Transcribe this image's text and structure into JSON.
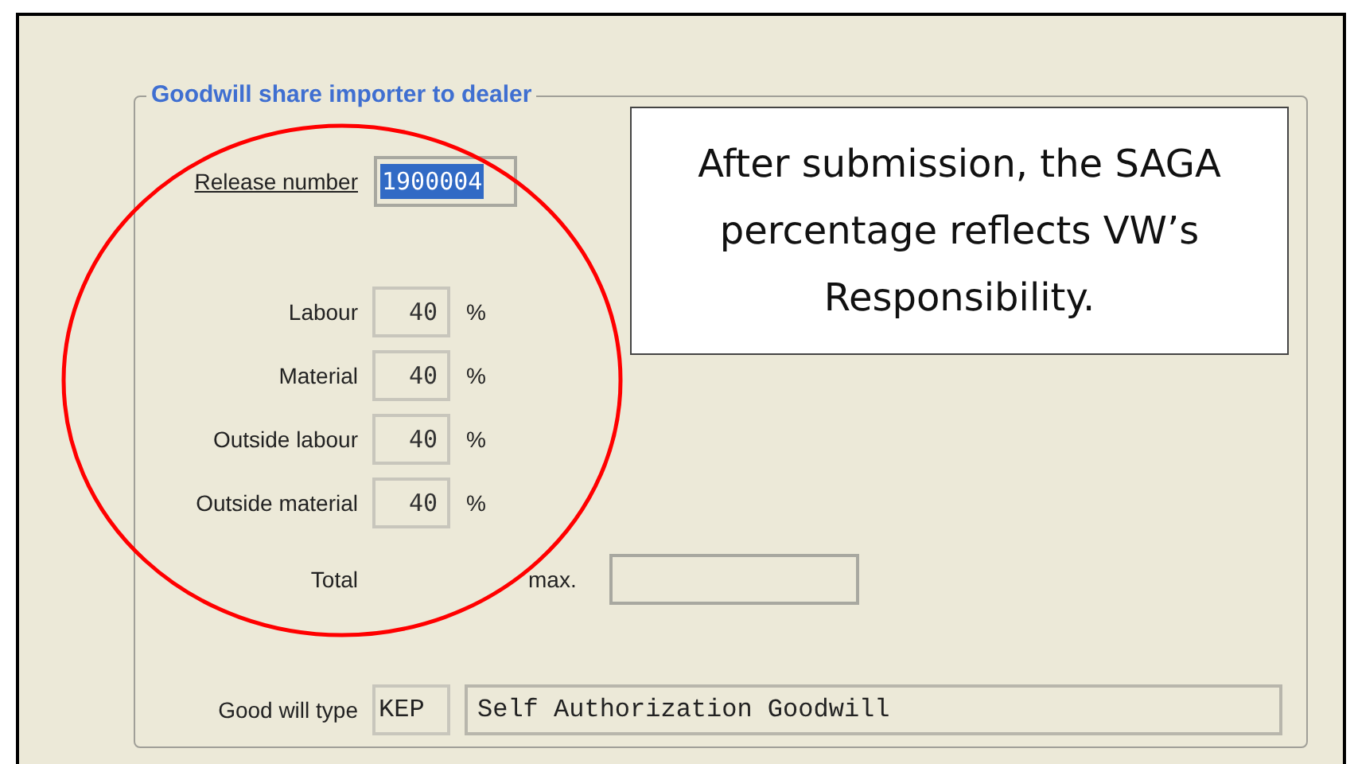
{
  "group": {
    "title": "Goodwill share importer to dealer"
  },
  "release": {
    "label": "Release number",
    "value": "1900004",
    "selected": true
  },
  "shares": [
    {
      "label": "Labour",
      "value": "40",
      "unit": "%"
    },
    {
      "label": "Material",
      "value": "40",
      "unit": "%"
    },
    {
      "label": "Outside labour",
      "value": "40",
      "unit": "%"
    },
    {
      "label": "Outside material",
      "value": "40",
      "unit": "%"
    }
  ],
  "total": {
    "label": "Total",
    "max_label": "max."
  },
  "goodwill_type": {
    "label": "Good will type",
    "code": "KEP",
    "description": "Self Authorization Goodwill"
  },
  "callout": {
    "text": "After submission, the SAGA percentage reflects VW’s Responsibility."
  }
}
